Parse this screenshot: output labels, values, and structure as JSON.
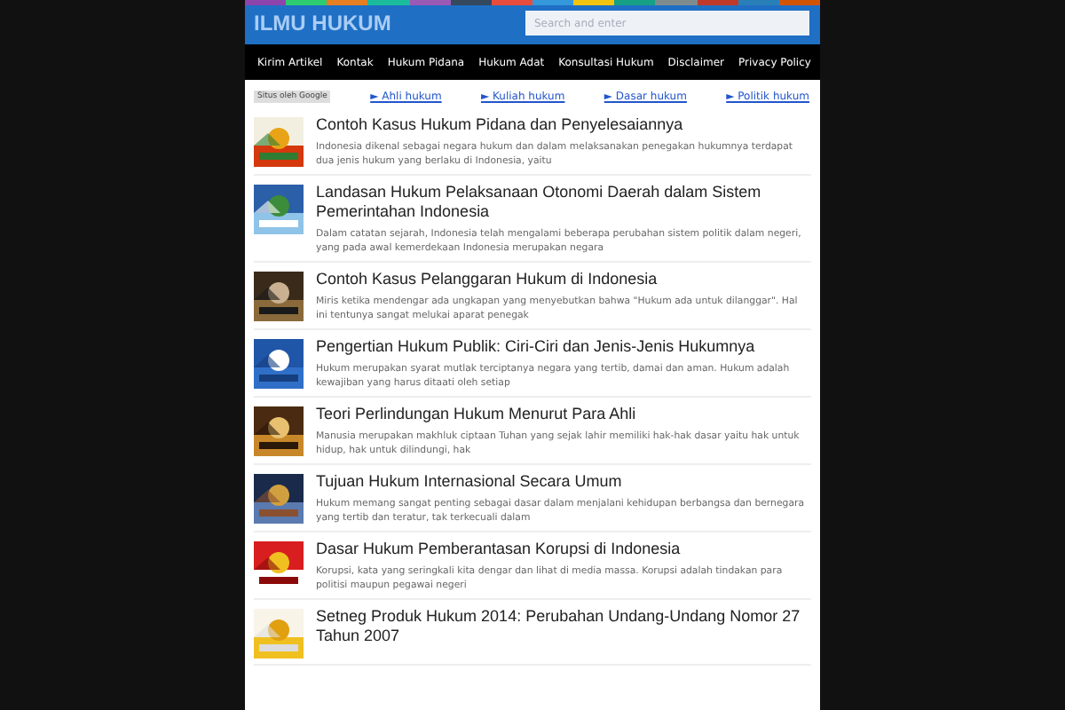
{
  "site_title": "ILMU HUKUM",
  "search": {
    "placeholder": "Search and enter"
  },
  "nav": [
    "Kirim Artikel",
    "Kontak",
    "Hukum Pidana",
    "Hukum Adat",
    "Konsultasi Hukum",
    "Disclaimer",
    "Privacy Policy"
  ],
  "ad_links": {
    "badge": "Situs oleh Google",
    "links": [
      "► Ahli hukum",
      "► Kuliah hukum",
      "► Dasar hukum",
      "► Politik hukum"
    ]
  },
  "articles": [
    {
      "title": "Contoh Kasus Hukum Pidana dan Penyelesaiannya",
      "excerpt": "Indonesia dikenal sebagai negara hukum dan dalam melaksanakan penegakan hukumnya terdapat dua jenis hukum yang berlaku di Indonesia, yaitu"
    },
    {
      "title": "Landasan Hukum Pelaksanaan Otonomi Daerah dalam Sistem Pemerintahan Indonesia",
      "excerpt": "Dalam catatan sejarah, Indonesia telah mengalami beberapa perubahan sistem politik dalam negeri, yang pada awal kemerdekaan Indonesia merupakan negara"
    },
    {
      "title": "Contoh Kasus Pelanggaran Hukum di Indonesia",
      "excerpt": "Miris ketika mendengar ada ungkapan yang menyebutkan bahwa \"Hukum ada untuk dilanggar\". Hal ini tentunya sangat melukai aparat penegak"
    },
    {
      "title": "Pengertian Hukum Publik: Ciri-Ciri dan Jenis-Jenis Hukumnya",
      "excerpt": "Hukum merupakan syarat mutlak terciptanya negara yang tertib, damai dan aman. Hukum adalah kewajiban yang harus ditaati oleh setiap"
    },
    {
      "title": "Teori Perlindungan Hukum Menurut Para Ahli",
      "excerpt": "Manusia merupakan makhluk ciptaan Tuhan yang sejak lahir memiliki hak-hak dasar yaitu hak untuk hidup, hak untuk dilindungi, hak"
    },
    {
      "title": "Tujuan Hukum Internasional Secara Umum",
      "excerpt": "Hukum memang sangat penting sebagai dasar dalam menjalani kehidupan berbangsa dan bernegara yang tertib dan teratur, tak terkecuali dalam"
    },
    {
      "title": "Dasar Hukum Pemberantasan Korupsi di Indonesia",
      "excerpt": "Korupsi, kata yang seringkali kita dengar dan lihat di media massa. Korupsi adalah tindakan para politisi maupun pegawai negeri"
    },
    {
      "title": "Setneg Produk Hukum 2014: Perubahan Undang-Undang Nomor 27 Tahun 2007"
    }
  ]
}
